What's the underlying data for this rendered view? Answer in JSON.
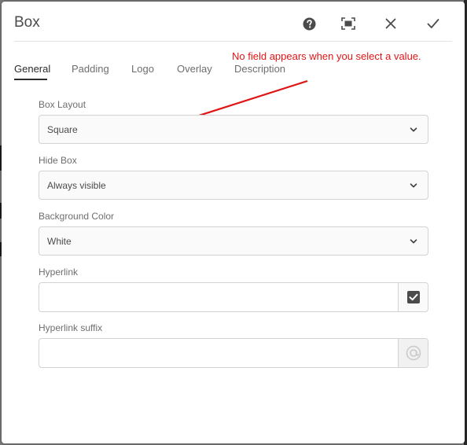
{
  "dialog": {
    "title": "Box",
    "actions": [
      {
        "name": "help",
        "icon": "help-icon"
      },
      {
        "name": "fullscreen",
        "icon": "fullscreen-icon"
      },
      {
        "name": "close",
        "icon": "close-icon"
      },
      {
        "name": "done",
        "icon": "checkmark-icon"
      }
    ]
  },
  "tabs": [
    {
      "label": "General",
      "active": true
    },
    {
      "label": "Padding",
      "active": false
    },
    {
      "label": "Logo",
      "active": false
    },
    {
      "label": "Overlay",
      "active": false
    },
    {
      "label": "Description",
      "active": false
    }
  ],
  "annotation": {
    "text": "No field appears when you select a value.",
    "color": "#e01616"
  },
  "fields": {
    "box_layout": {
      "label": "Box Layout",
      "value": "Square"
    },
    "hide_box": {
      "label": "Hide Box",
      "value": "Always visible"
    },
    "background_color": {
      "label": "Background Color",
      "value": "White"
    },
    "hyperlink": {
      "label": "Hyperlink",
      "value": "",
      "button_icon": "checkbox-icon"
    },
    "hyperlink_suffix": {
      "label": "Hyperlink suffix",
      "value": "",
      "button_icon": "link-icon"
    }
  }
}
